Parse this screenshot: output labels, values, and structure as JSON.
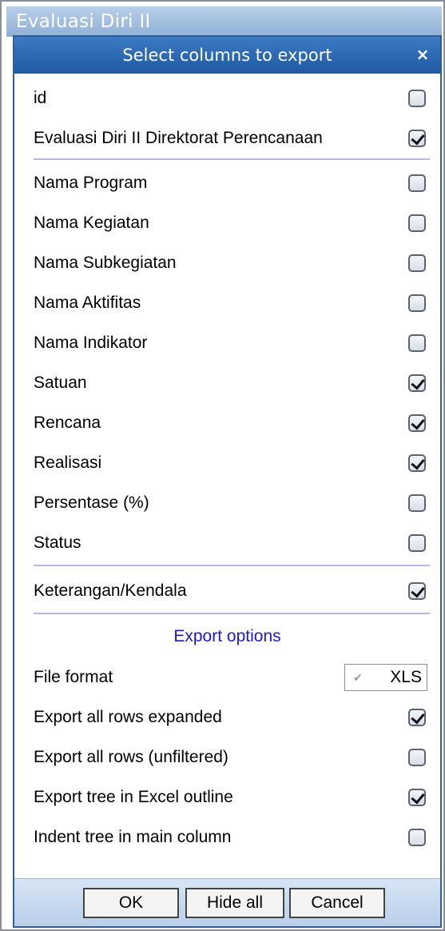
{
  "window": {
    "title": "Evaluasi Diri II"
  },
  "dialog": {
    "title": "Select columns to export",
    "close_label": "×",
    "columns_top": [
      {
        "label": "id",
        "checked": false
      },
      {
        "label": "Evaluasi Diri II Direktorat Perencanaan",
        "checked": true
      }
    ],
    "columns_main": [
      {
        "label": "Nama Program",
        "checked": false
      },
      {
        "label": "Nama Kegiatan",
        "checked": false
      },
      {
        "label": "Nama Subkegiatan",
        "checked": false
      },
      {
        "label": "Nama Aktifitas",
        "checked": false
      },
      {
        "label": "Nama Indikator",
        "checked": false
      },
      {
        "label": "Satuan",
        "checked": true
      },
      {
        "label": "Rencana",
        "checked": true
      },
      {
        "label": "Realisasi",
        "checked": true
      },
      {
        "label": "Persentase (%)",
        "checked": false
      },
      {
        "label": "Status",
        "checked": false
      }
    ],
    "columns_bottom": [
      {
        "label": "Keterangan/Kendala",
        "checked": true
      }
    ],
    "export_options": {
      "title": "Export options",
      "file_format_label": "File format",
      "file_format_value": "XLS",
      "options": [
        {
          "label": "Export all rows expanded",
          "checked": true
        },
        {
          "label": "Export all rows (unfiltered)",
          "checked": false
        },
        {
          "label": "Export tree in Excel outline",
          "checked": true
        },
        {
          "label": "Indent tree in main column",
          "checked": false
        }
      ]
    },
    "buttons": {
      "ok": "OK",
      "hide_all": "Hide all",
      "cancel": "Cancel"
    }
  }
}
